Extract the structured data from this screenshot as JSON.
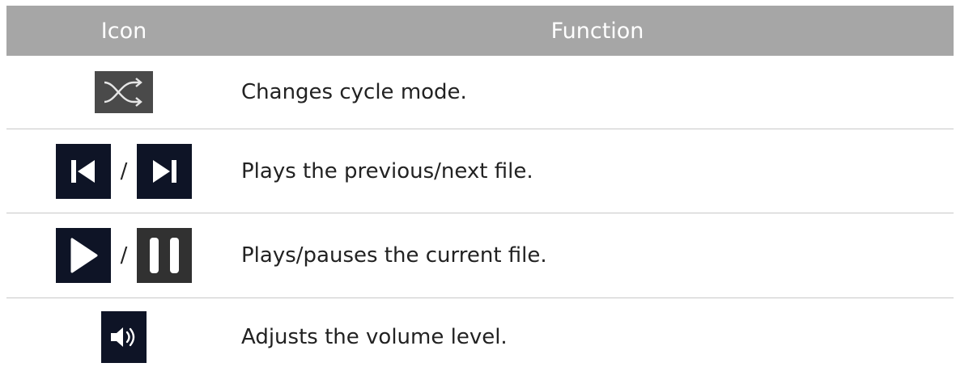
{
  "table": {
    "header": {
      "icon": "Icon",
      "function": "Function"
    },
    "rows": [
      {
        "icons": [
          "shuffle-icon"
        ],
        "function": "Changes cycle mode."
      },
      {
        "icons": [
          "previous-icon",
          "next-icon"
        ],
        "separator": "/",
        "function": "Plays the previous/next file."
      },
      {
        "icons": [
          "play-icon",
          "pause-icon"
        ],
        "separator": "/",
        "function": "Plays/pauses the current file."
      },
      {
        "icons": [
          "volume-icon"
        ],
        "function": "Adjusts the volume level."
      }
    ]
  },
  "colors": {
    "header_bg": "#a6a6a6",
    "icon_navy": "#0e1426",
    "icon_gray": "#313131",
    "row_divider": "#c8c8c8"
  }
}
